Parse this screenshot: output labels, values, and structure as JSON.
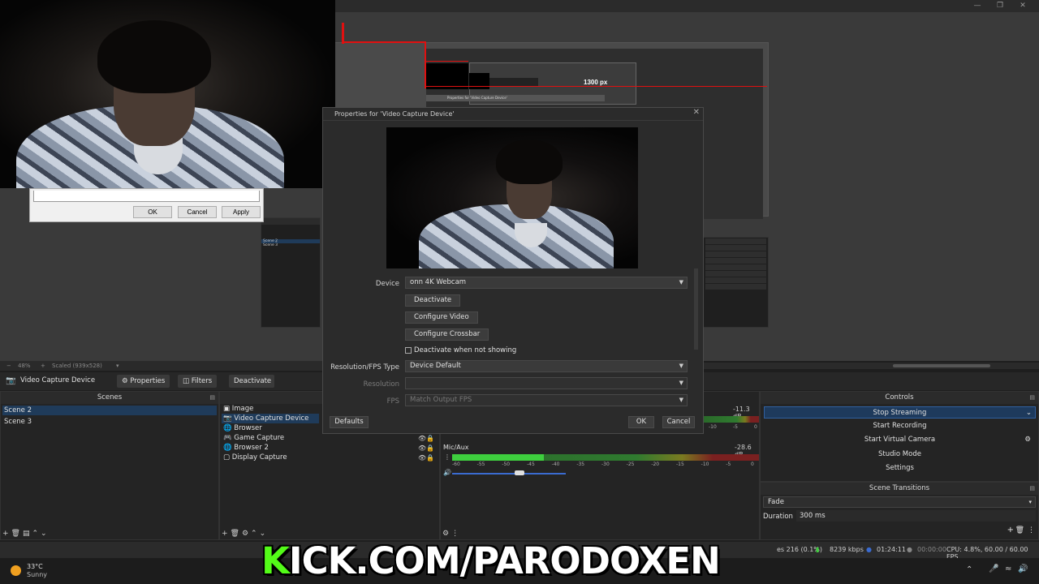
{
  "colors": {
    "accent": "#53fc18",
    "selection": "#1f3b5a",
    "redline": "#e01010"
  },
  "preview": {
    "inner_width_label": "1300 px",
    "zoom": "48%",
    "scaled": "Scaled (939x528)",
    "inner_title": "Properties for 'Video Capture Device'"
  },
  "old_dialog": {
    "ok": "OK",
    "cancel": "Cancel",
    "apply": "Apply"
  },
  "dialog": {
    "title": "Properties for 'Video Capture Device'",
    "device_label": "Device",
    "device_value": "onn 4K Webcam",
    "deactivate": "Deactivate",
    "configure_video": "Configure Video",
    "configure_crossbar": "Configure Crossbar",
    "deactivate_hidden": "Deactivate when not showing",
    "res_type_label": "Resolution/FPS Type",
    "res_type_value": "Device Default",
    "resolution_label": "Resolution",
    "fps_label": "FPS",
    "fps_value": "Match Output FPS",
    "defaults": "Defaults",
    "ok": "OK",
    "cancel": "Cancel"
  },
  "source_bar": {
    "source_name": "Video Capture Device",
    "properties": "Properties",
    "filters": "Filters",
    "deactivate": "Deactivate"
  },
  "scenes": {
    "title": "Scenes",
    "items": [
      "Scene 2",
      "Scene 3"
    ],
    "inner_items": [
      "Scene 2",
      "Scene 3"
    ]
  },
  "sources": {
    "title": "So",
    "items": [
      "Image",
      "Video Capture Device",
      "Browser",
      "Game Capture",
      "Browser 2",
      "Display Capture"
    ]
  },
  "mixer": {
    "track1_db": "-11.3 dB",
    "track2_name": "Mic/Aux",
    "track2_db": "-28.6 dB",
    "ticks": [
      "-60",
      "-55",
      "-50",
      "-45",
      "-40",
      "-35",
      "-30",
      "-25",
      "-20",
      "-15",
      "-10",
      "-5",
      "0"
    ],
    "track1_ticks": [
      "-10",
      "-5",
      "0"
    ],
    "track2_level": 0.3,
    "track2_volume": 0.55
  },
  "controls": {
    "title": "Controls",
    "stop_streaming": "Stop Streaming",
    "start_recording": "Start Recording",
    "start_virtual_camera": "Start Virtual Camera",
    "studio_mode": "Studio Mode",
    "settings": "Settings"
  },
  "transitions": {
    "title": "Scene Transitions",
    "type": "Fade",
    "duration_label": "Duration",
    "duration_value": "300 ms"
  },
  "status": {
    "frames": "es 216 (0.1%)",
    "kbps": "8239 kbps",
    "live_time": "01:24:11",
    "rec_time": "00:00:00",
    "cpu": "CPU: 4.8%, 60.00 / 60.00 FPS"
  },
  "weather": {
    "temp": "33°C",
    "desc": "Sunny"
  },
  "overlay": {
    "k": "K",
    "rest": "ICK.COM/PARODOXEN"
  }
}
